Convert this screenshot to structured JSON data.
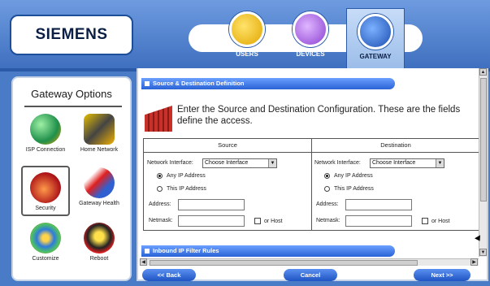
{
  "header": {
    "logo_text": "SIEMENS",
    "tabs": [
      {
        "label": "USERS",
        "icon": "users-icon"
      },
      {
        "label": "DEVICES",
        "icon": "devices-icon"
      },
      {
        "label": "GATEWAY",
        "icon": "gateway-icon",
        "selected": true
      }
    ]
  },
  "sidebar": {
    "title": "Gateway Options",
    "items": [
      {
        "label": "ISP Connection",
        "icon": "globe-icon"
      },
      {
        "label": "Home Network",
        "icon": "network-icon"
      },
      {
        "label": "Security",
        "icon": "lock-icon",
        "selected": true
      },
      {
        "label": "Gateway Health",
        "icon": "thermometer-icon"
      },
      {
        "label": "Customize",
        "icon": "palette-icon"
      },
      {
        "label": "Reboot",
        "icon": "reboot-icon"
      }
    ]
  },
  "main": {
    "section1_title": "Source & Destination Definition",
    "intro_text": "Enter the Source and Destination Configuration. These are the fields define the access.",
    "source": {
      "title": "Source",
      "network_interface_label": "Network Interface:",
      "network_interface_value": "Choose Interface",
      "any_ip_label": "Any IP Address",
      "this_ip_label": "This IP Address",
      "address_label": "Address:",
      "address_value": "",
      "netmask_label": "Netmask:",
      "netmask_value": "",
      "or_host_label": "or Host",
      "selected_radio": "any"
    },
    "destination": {
      "title": "Destination",
      "network_interface_label": "Network Interface:",
      "network_interface_value": "Choose Interface",
      "any_ip_label": "Any IP Address",
      "this_ip_label": "This IP Address",
      "address_label": "Address:",
      "address_value": "",
      "netmask_label": "Netmask:",
      "netmask_value": "",
      "or_host_label": "or Host",
      "selected_radio": "any"
    },
    "section2_title": "Inbound IP Filter Rules"
  },
  "footer": {
    "back_label": "<< Back",
    "cancel_label": "Cancel",
    "next_label": "Next >>"
  },
  "colors": {
    "background": "#4a7bc6",
    "accent": "#2a63d6",
    "panel": "#ffffff"
  }
}
